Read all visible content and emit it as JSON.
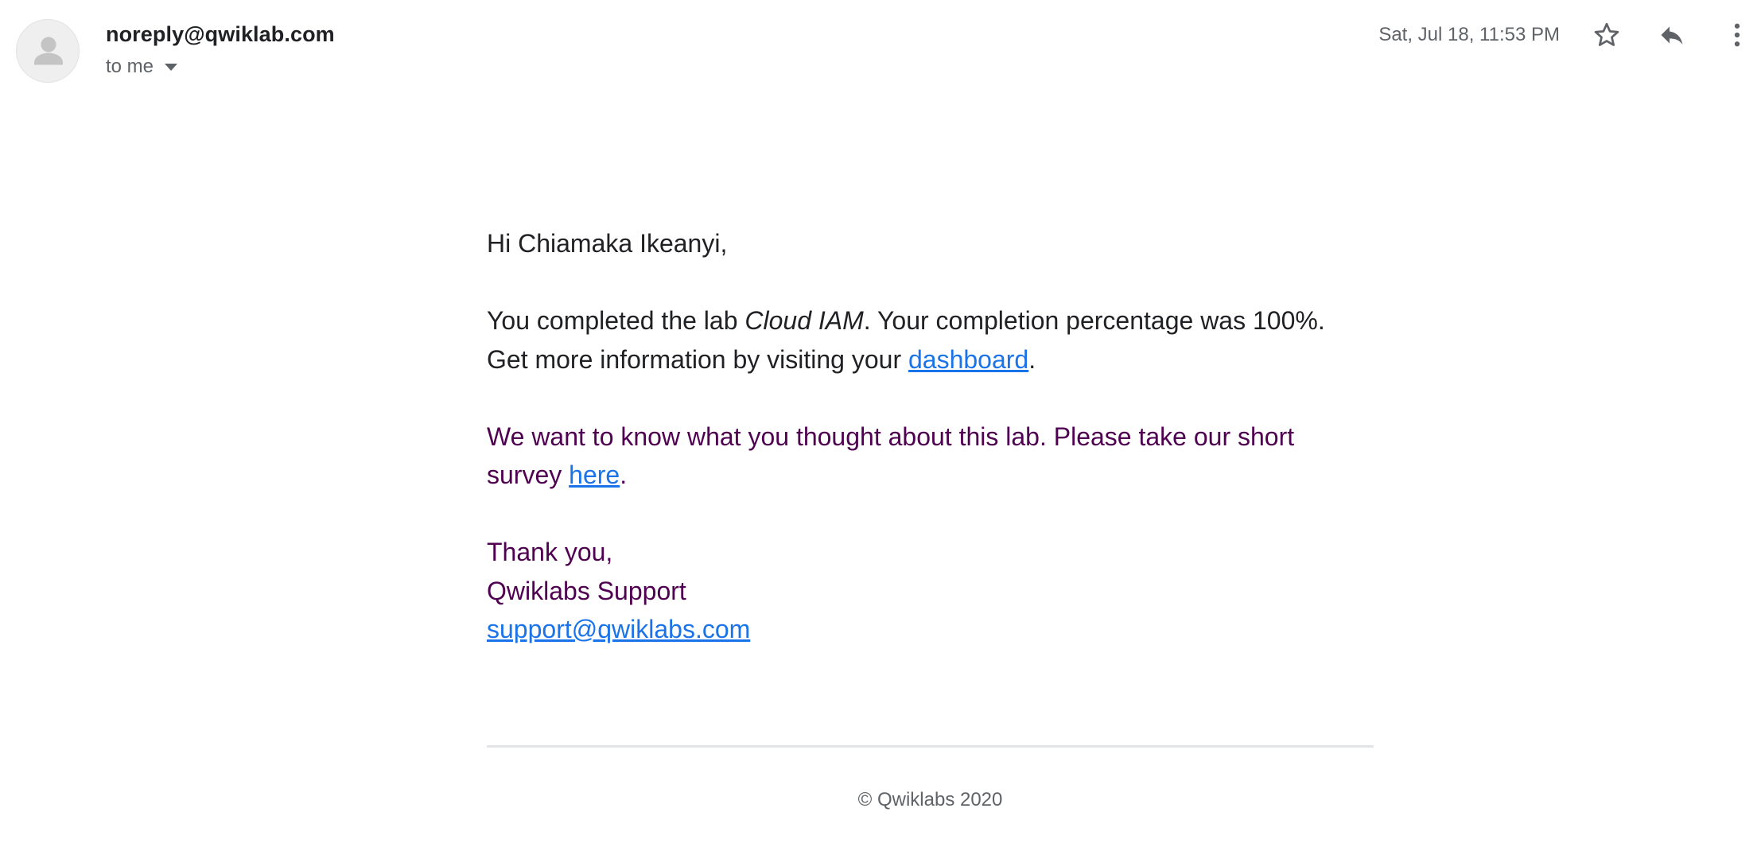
{
  "email": {
    "sender": "noreply@qwiklab.com",
    "recipient_label": "to me",
    "date": "Sat, Jul 18, 11:53 PM",
    "icons": {
      "avatar": "person-icon",
      "recipient_dropdown": "caret-down-icon",
      "star": "star-outline-icon",
      "reply": "reply-icon",
      "more": "more-vert-icon"
    }
  },
  "body": {
    "greeting": "Hi Chiamaka Ikeanyi,",
    "completion_prefix": "You completed the lab ",
    "lab_name": "Cloud IAM",
    "completion_suffix": ". Your completion percentage was 100%.",
    "info_prefix": "Get more information by visiting your ",
    "dashboard_link": "dashboard",
    "info_suffix": ".",
    "survey_prefix": "We want to know what you thought about this lab. Please take our short survey ",
    "survey_link": "here",
    "survey_suffix": ".",
    "signoff": "Thank you,",
    "signature": "Qwiklabs Support",
    "support_email": "support@qwiklabs.com"
  },
  "footer": {
    "copyright": "© Qwiklabs 2020"
  },
  "colors": {
    "link": "#1a73e8",
    "purple_text": "#500050",
    "body_text": "#202124",
    "muted_text": "#5f6368"
  }
}
